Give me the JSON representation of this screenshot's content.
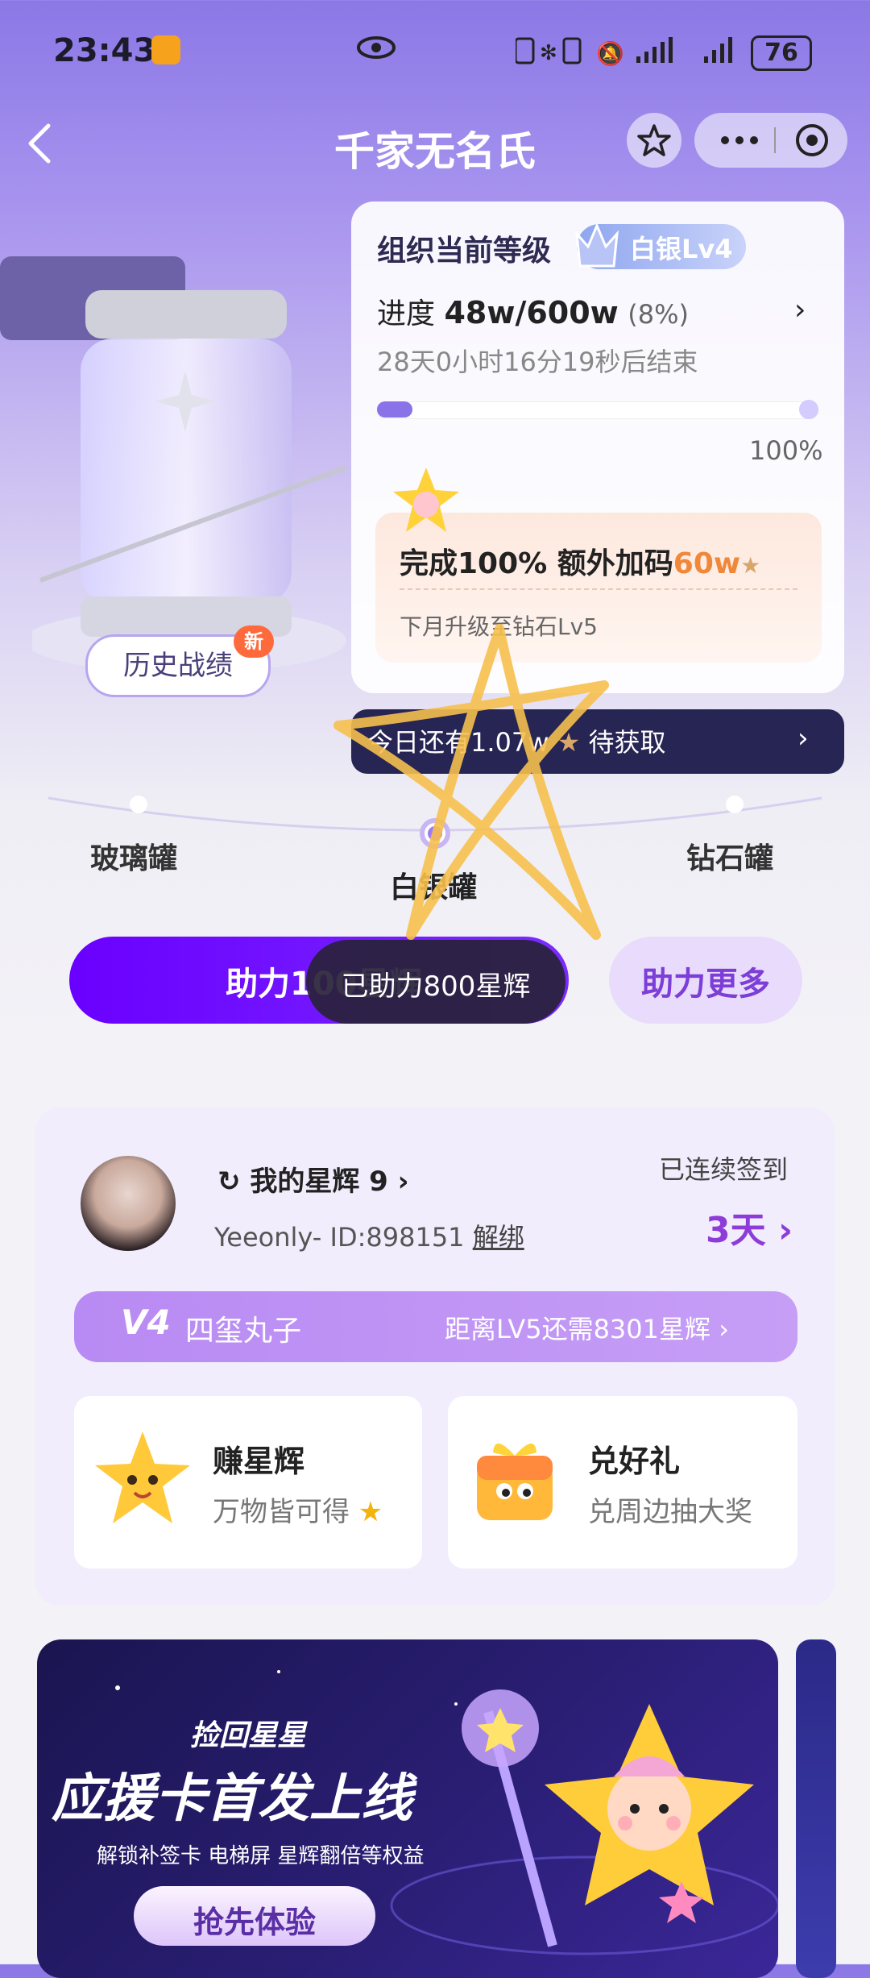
{
  "status_bar": {
    "time": "23:43",
    "battery": "76"
  },
  "nav": {
    "title": "千家无名氏"
  },
  "history": {
    "label": "历史战绩",
    "new_badge": "新"
  },
  "level_card": {
    "title": "组织当前等级",
    "level_badge": "白银Lv4",
    "progress_label": "进度",
    "progress_value": "48w/600w",
    "progress_percent": "(8%)",
    "progress_fraction": 0.08,
    "countdown": "28天0小时16分19秒后结束",
    "bar_end_label": "100%",
    "bonus_prefix": "完成100% 额外加码",
    "bonus_amount": "60w",
    "bonus_sub": "下月升级至钻石Lv5"
  },
  "today": {
    "text": "今日还有1.07w",
    "suffix": "待获取"
  },
  "jar_track": {
    "left": "玻璃罐",
    "center": "白银罐",
    "right": "钻石罐"
  },
  "assist": {
    "main_label": "助力100星辉",
    "more_label": "助力更多",
    "toast": "已助力800星辉"
  },
  "member": {
    "my_star_label": "我的星辉 9",
    "uid_text": "Yeeonly- ID:898151",
    "unbind": "解绑",
    "signed_label": "已连续签到",
    "signed_days": "3天",
    "vip_level": "V4",
    "vip_name": "四玺丸子",
    "vip_next": "距离LV5还需8301星辉",
    "tiles": [
      {
        "title": "赚星辉",
        "sub": "万物皆可得"
      },
      {
        "title": "兑好礼",
        "sub": "兑周边抽大奖"
      }
    ]
  },
  "banner": {
    "sub": "捡回星星",
    "title": "应援卡首发上线",
    "desc": "解锁补签卡 电梯屏 星辉翻倍等权益",
    "button": "抢先体验"
  }
}
